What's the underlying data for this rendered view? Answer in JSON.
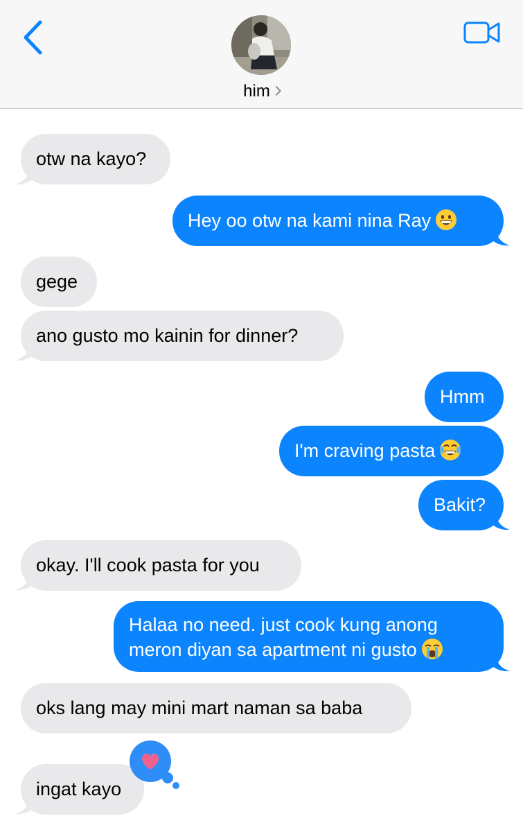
{
  "header": {
    "contact_name": "him"
  },
  "messages": [
    {
      "id": 1,
      "direction": "incoming",
      "text": "otw na kayo?"
    },
    {
      "id": 2,
      "direction": "outgoing",
      "text": "Hey oo otw na kami nina Ray",
      "emoji": "grinning-face"
    },
    {
      "id": 3,
      "direction": "incoming",
      "text": "gege"
    },
    {
      "id": 4,
      "direction": "incoming",
      "text": "ano gusto mo kainin for dinner?"
    },
    {
      "id": 5,
      "direction": "outgoing",
      "text": "Hmm"
    },
    {
      "id": 6,
      "direction": "outgoing",
      "text": "I'm craving pasta",
      "emoji": "tears-of-joy-face"
    },
    {
      "id": 7,
      "direction": "outgoing",
      "text": "Bakit?"
    },
    {
      "id": 8,
      "direction": "incoming",
      "text": "okay. I'll cook pasta for you"
    },
    {
      "id": 9,
      "direction": "outgoing",
      "lines": [
        "Halaa no need. just cook kung anong",
        "meron diyan sa apartment ni gusto"
      ],
      "emoji": "loudly-crying-face"
    },
    {
      "id": 10,
      "direction": "incoming",
      "text": "oks lang may mini mart naman sa baba"
    },
    {
      "id": 11,
      "direction": "incoming",
      "text": "ingat kayo",
      "tapback": "heart"
    }
  ],
  "colors": {
    "accent": "#0b84fe",
    "incoming_bubble": "#e9e9eb",
    "header_bg": "#f7f7f7",
    "tapback_heart": "#f0628e"
  },
  "icons": {
    "back": "chevron-left-icon",
    "video": "video-camera-icon",
    "tapback": "heart-icon"
  }
}
